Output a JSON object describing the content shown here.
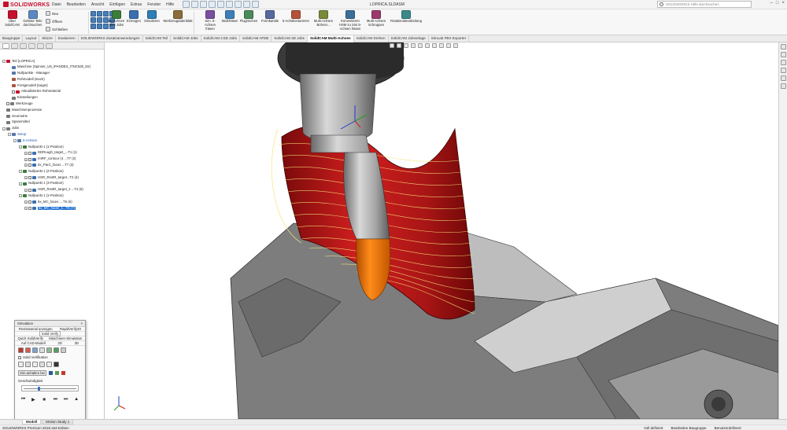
{
  "app": {
    "logo": "SOLIDWORKS",
    "doc_title": "LOPRICA.SLDASM",
    "search_placeholder": "SOLIDWORKS Hilfe durchsuchen"
  },
  "menu": [
    "Datei",
    "Bearbeiten",
    "Ansicht",
    "Einfügen",
    "Extras",
    "Fenster",
    "Hilfe"
  ],
  "ribbon": {
    "left_buttons": [
      {
        "label": "Über SolidCAM",
        "icon": "solidcam-info-icon"
      },
      {
        "label": "Gelöste Teile durchsuchen",
        "icon": "search-parts-icon"
      }
    ],
    "file_group": [
      {
        "label": "Neu",
        "icon": "new-icon"
      },
      {
        "label": "Öffnen",
        "icon": "open-icon"
      },
      {
        "label": "Schließen",
        "icon": "close-file-icon"
      }
    ],
    "main_buttons": [
      {
        "label": "Berechnen aller Jobs",
        "color": "#3a7d3a"
      },
      {
        "label": "Erzeugen",
        "color": "#3b6fb0"
      },
      {
        "label": "Simulieren",
        "color": "#2e7fb5"
      },
      {
        "label": "Werkzeugdatenblatt",
        "color": "#8a6d3b"
      },
      {
        "label": "Sim. 5-Achsen fräsen",
        "color": "#7a4fa0"
      },
      {
        "label": "Walzfräsen",
        "color": "#3f7fb8"
      },
      {
        "label": "Flugzeichen",
        "color": "#4b8a5a"
      },
      {
        "label": "Formkanäle",
        "color": "#556b9f"
      },
      {
        "label": "5-Achskonturieren",
        "color": "#b5523a"
      },
      {
        "label": "Multi-Achsen Bohren...",
        "color": "#7a8a3b"
      },
      {
        "label": "Konvertieren HSM zu Sim 5-Achsen fräsen",
        "color": "#3a6f9a"
      },
      {
        "label": "Multi-Achsen Schruppen",
        "color": "#9a3a6a"
      },
      {
        "label": "Rotationsbearbeitung",
        "color": "#3b8a8a"
      }
    ]
  },
  "tabs": [
    "Baugruppe",
    "Layout",
    "Skizze",
    "Evaluieren",
    "SOLIDWORKS Zusatzanwendungen",
    "SolidCAM Teil",
    "SolidCAM Jobs",
    "SolidCAM 2.5D Jobs",
    "SolidCAM AFEB",
    "SolidCAM 3D Jobs",
    "SolidCAM Multi-Achsen",
    "SolidCAM Drehen",
    "SolidCAM Jobvorlage",
    "SimLab FBX Exporter"
  ],
  "active_tab": "SolidCAM Multi-Achsen",
  "tree": [
    {
      "level": 0,
      "label": "Teil (LOPRICA)",
      "icon": "#c8102e",
      "toggle": "-"
    },
    {
      "level": 1,
      "label": "Maschine (Spinner_U5_iPANDEX_ITNC630_5X)",
      "icon": "#5577aa"
    },
    {
      "level": 1,
      "label": "Nullpunkte - Manager",
      "icon": "#5577aa"
    },
    {
      "level": 1,
      "label": "Rohmodell (stock)",
      "icon": "#aa5544"
    },
    {
      "level": 1,
      "label": "Fertigmodell (target)",
      "icon": "#aa5544"
    },
    {
      "level": 1,
      "label": "Aktualisiertes Rohmaterial",
      "icon": "#c8102e",
      "checkbox": true
    },
    {
      "level": 1,
      "label": "Einstellungen",
      "icon": "#777777"
    },
    {
      "level": 0,
      "label": "Werkzeuge",
      "icon": "#777777",
      "checkbox": true
    },
    {
      "level": 0,
      "label": "Maschinenprozesse",
      "icon": "#777777"
    },
    {
      "level": 0,
      "label": "Geometrie",
      "icon": "#777777"
    },
    {
      "level": 0,
      "label": "Spannmittel",
      "icon": "#777777"
    },
    {
      "level": 0,
      "label": "Jobs",
      "icon": "#777777",
      "toggle": "-"
    },
    {
      "level": 1,
      "label": "Setup",
      "icon": "#5577aa",
      "toggle": "-",
      "blue": true
    },
    {
      "level": 2,
      "label": "5-Achsen",
      "icon": "#5577aa",
      "toggle": "-",
      "blue": true
    },
    {
      "level": 3,
      "label": "Nullpunkt 1 (1-Position)",
      "icon": "#3a7d3a",
      "toggle": "-"
    },
    {
      "level": 4,
      "label": "DDRough_target_...T1 (1)",
      "icon": "#3b6fb0",
      "toggle": "+",
      "checkbox": true
    },
    {
      "level": 4,
      "label": "ImRF_contour (4 ...T7 (2)",
      "icon": "#3b6fb0",
      "toggle": "+",
      "checkbox": true
    },
    {
      "level": 4,
      "label": "5x_ParC_faces ...T7 (3)",
      "icon": "#3b6fb0",
      "toggle": "+",
      "checkbox": true
    },
    {
      "level": 3,
      "label": "Nullpunkt 1 (2-Position)",
      "icon": "#3a7d3a",
      "toggle": "-"
    },
    {
      "level": 4,
      "label": "HSR_RestR_target...T2 (4)",
      "icon": "#3b6fb0",
      "toggle": "+",
      "checkbox": true
    },
    {
      "level": 3,
      "label": "Nullpunkt 1 (3-Position)",
      "icon": "#3a7d3a",
      "toggle": "-"
    },
    {
      "level": 4,
      "label": "HSR_RestR_target_1 ...T2 (5)",
      "icon": "#3b6fb0",
      "toggle": "+",
      "checkbox": true
    },
    {
      "level": 3,
      "label": "Nullpunkt 1 (1-Position)",
      "icon": "#3a7d3a",
      "toggle": "-"
    },
    {
      "level": 4,
      "label": "5x_MC_faces ... T6 (6)",
      "icon": "#3b6fb0",
      "toggle": "+",
      "checkbox": true
    },
    {
      "level": 4,
      "label": "5x_MC_faces_1...T6 (7)",
      "icon": "#3b6fb0",
      "toggle": "+",
      "checkbox": true,
      "selected": true
    }
  ],
  "simulation": {
    "title": "Simulation",
    "row1": [
      "Restmaterial anzeigen",
      "RapidVerify3X"
    ],
    "row2": [
      "Solid Verify"
    ],
    "row3": [
      "Quick SolidVerify",
      "Maschinen-Simulation"
    ],
    "row4": [
      "Auf CAD-Modell",
      "2D",
      "3D"
    ],
    "solid_verification": "Solid Verifikation",
    "sim_button": "Sim.anhalten bei",
    "speed_label": "Geschwindigkeit",
    "speed_value": 0.3
  },
  "bottom_tabs": [
    "Modell",
    "Motion Study 1"
  ],
  "status": {
    "left": "SOLIDWORKS Premium 2018 x64-Edition",
    "items": [
      "Voll definiert",
      "Bearbeiten Baugruppe",
      "Benutzerdefiniert"
    ]
  }
}
